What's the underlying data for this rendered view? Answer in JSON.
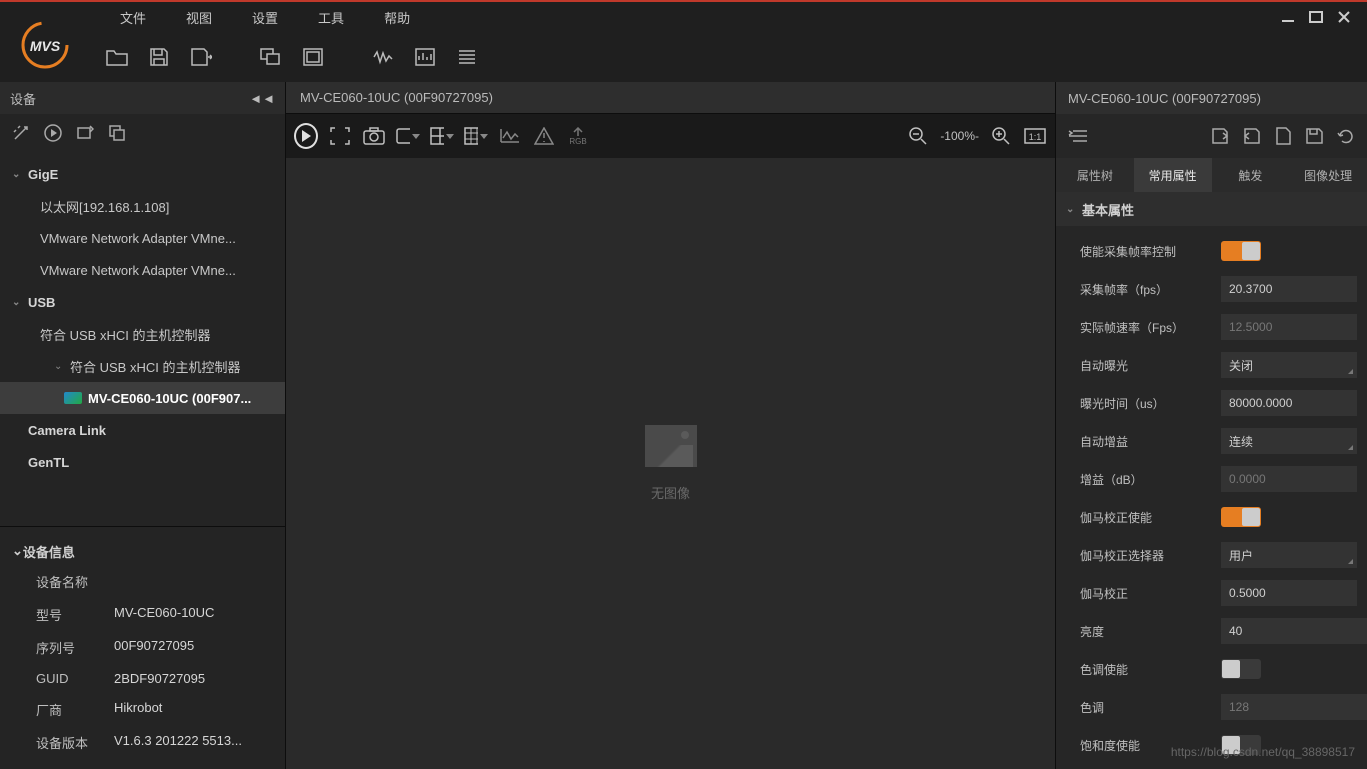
{
  "menu": {
    "file": "文件",
    "view": "视图",
    "settings": "设置",
    "tools": "工具",
    "help": "帮助"
  },
  "left": {
    "header": "设备",
    "gige": "GigE",
    "eth": "以太网[192.168.1.108]",
    "vm1": "VMware Network Adapter VMne...",
    "vm2": "VMware Network Adapter VMne...",
    "usb": "USB",
    "usb_h1": "符合 USB xHCI 的主机控制器",
    "usb_h2": "符合 USB xHCI 的主机控制器",
    "device": "MV-CE060-10UC (00F907...",
    "camlink": "Camera Link",
    "gentl": "GenTL"
  },
  "devinfo": {
    "header": "设备信息",
    "name_k": "设备名称",
    "name_v": "",
    "model_k": "型号",
    "model_v": "MV-CE060-10UC",
    "serial_k": "序列号",
    "serial_v": "00F90727095",
    "guid_k": "GUID",
    "guid_v": "2BDF90727095",
    "vendor_k": "厂商",
    "vendor_v": "Hikrobot",
    "ver_k": "设备版本",
    "ver_v": "V1.6.3 201222 5513..."
  },
  "center": {
    "tab": "MV-CE060-10UC (00F90727095)",
    "zoom": "-100%-",
    "noimage": "无图像",
    "rgb": "RGB"
  },
  "right": {
    "header": "MV-CE060-10UC (00F90727095)",
    "tabs": {
      "tree": "属性树",
      "common": "常用属性",
      "trigger": "触发",
      "imgproc": "图像处理"
    },
    "section": "基本属性",
    "rows": {
      "enable_fps_ctrl": "使能采集帧率控制",
      "acq_fps": "采集帧率（fps）",
      "acq_fps_v": "20.3700",
      "real_fps": "实际帧速率（Fps）",
      "real_fps_v": "12.5000",
      "auto_exp": "自动曝光",
      "auto_exp_v": "关闭",
      "exp_time": "曝光时间（us）",
      "exp_time_v": "80000.0000",
      "auto_gain": "自动增益",
      "auto_gain_v": "连续",
      "gain": "增益（dB）",
      "gain_v": "0.0000",
      "gamma_en": "伽马校正使能",
      "gamma_sel": "伽马校正选择器",
      "gamma_sel_v": "用户",
      "gamma": "伽马校正",
      "gamma_v": "0.5000",
      "bright": "亮度",
      "bright_v": "40",
      "hue_en": "色调使能",
      "hue": "色调",
      "hue_v": "128",
      "sat_en": "饱和度使能"
    }
  },
  "watermark": "https://blog.csdn.net/qq_38898517"
}
